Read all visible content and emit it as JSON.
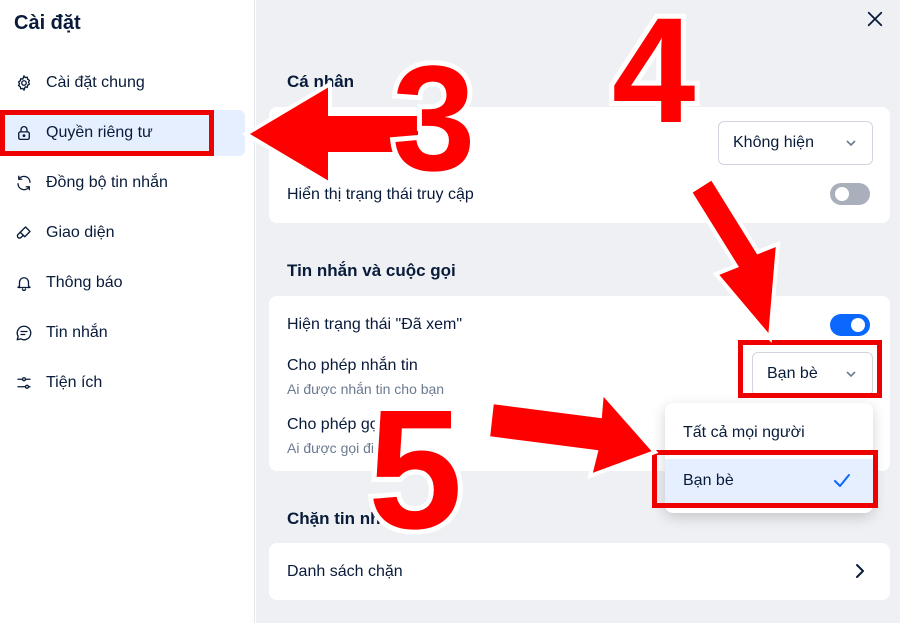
{
  "sidebar": {
    "title": "Cài đặt",
    "items": [
      {
        "label": "Cài đặt chung",
        "icon": "gear-icon"
      },
      {
        "label": "Quyền riêng tư",
        "icon": "lock-icon",
        "active": true
      },
      {
        "label": "Đồng bộ tin nhắn",
        "icon": "sync-icon"
      },
      {
        "label": "Giao diện",
        "icon": "brush-icon"
      },
      {
        "label": "Thông báo",
        "icon": "bell-icon"
      },
      {
        "label": "Tin nhắn",
        "icon": "chat-icon"
      },
      {
        "label": "Tiện ích",
        "icon": "sliders-icon"
      }
    ]
  },
  "main": {
    "personal": {
      "title": "Cá nhân",
      "birthday_select": "Không hiện",
      "access_status_label": "Hiển thị trạng thái truy cập",
      "access_status_on": false
    },
    "messages_calls": {
      "title": "Tin nhắn và cuộc gọi",
      "seen_label": "Hiện trạng thái \"Đã xem\"",
      "seen_on": true,
      "allow_message_label": "Cho phép nhắn tin",
      "allow_message_sub": "Ai được nhắn tin cho bạn",
      "allow_message_value": "Bạn bè",
      "allow_call_label": "Cho phép gọi",
      "allow_call_sub": "Ai được gọi điện"
    },
    "dropdown": {
      "options": [
        "Tất cả mọi người",
        "Bạn bè"
      ],
      "selected": "Bạn bè"
    },
    "block": {
      "title": "Chặn tin nh",
      "list_label": "Danh sách chặn"
    }
  },
  "annotations": {
    "numbers": [
      "3",
      "4",
      "5"
    ],
    "color": "#ff0000"
  },
  "colors": {
    "accent": "#0a68ff",
    "active_bg": "#e5efff",
    "panel_bg": "#eef0f3"
  }
}
